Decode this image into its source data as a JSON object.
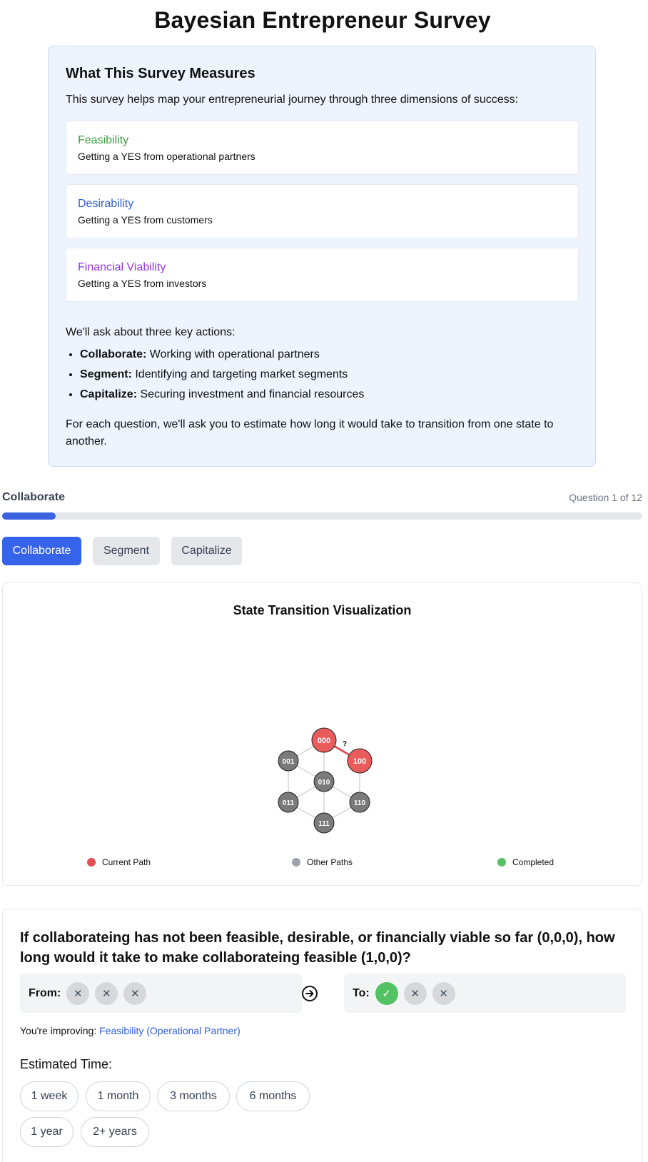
{
  "page_title": "Bayesian Entrepreneur Survey",
  "intro": {
    "heading": "What This Survey Measures",
    "lead": "This survey helps map your entrepreneurial journey through three dimensions of success:",
    "dimensions": [
      {
        "name": "Feasibility",
        "desc": "Getting a YES from operational partners",
        "color": "#3f9c46"
      },
      {
        "name": "Desirability",
        "desc": "Getting a YES from customers",
        "color": "#2f5fdc"
      },
      {
        "name": "Financial Viability",
        "desc": "Getting a YES from investors",
        "color": "#9333ea"
      }
    ],
    "actions_title": "We'll ask about three key actions:",
    "actions": [
      {
        "term": "Collaborate:",
        "desc": " Working with operational partners"
      },
      {
        "term": "Segment:",
        "desc": " Identifying and targeting market segments"
      },
      {
        "term": "Capitalize:",
        "desc": " Securing investment and financial resources"
      }
    ],
    "footnote": "For each question, we'll ask you to estimate how long it would take to transition from one state to another."
  },
  "progress": {
    "label": "Collaborate",
    "count": "Question 1 of 12",
    "fraction": 0.0833
  },
  "tabs": [
    "Collaborate",
    "Segment",
    "Capitalize"
  ],
  "active_tab": "Collaborate",
  "visualization": {
    "title": "State Transition Visualization",
    "nodes": [
      {
        "label": "000",
        "status": "current"
      },
      {
        "label": "100",
        "status": "current"
      },
      {
        "label": "001",
        "status": "other"
      },
      {
        "label": "010",
        "status": "other"
      },
      {
        "label": "011",
        "status": "other"
      },
      {
        "label": "110",
        "status": "other"
      },
      {
        "label": "111",
        "status": "other"
      }
    ],
    "edge_question_mark": "?",
    "legend": [
      {
        "label": "Current Path",
        "color": "#e05252"
      },
      {
        "label": "Other Paths",
        "color": "#9ca3af"
      },
      {
        "label": "Completed",
        "color": "#54c163"
      }
    ],
    "colors": {
      "current": "#ea5b5b",
      "other": "#7a7a7a",
      "edge_active": "#e05252",
      "edge": "#cccccc"
    }
  },
  "question": {
    "text": "If collaborateing has not been feasible, desirable, or financially viable so far (0,0,0), how long would it take to make collaborateing feasible (1,0,0)?",
    "from_label": "From:",
    "to_label": "To:",
    "from_states": [
      "no",
      "no",
      "no"
    ],
    "to_states": [
      "yes",
      "no",
      "no"
    ],
    "improving_prefix": "You're improving: ",
    "improving_dimension": "Feasibility (Operational Partner)",
    "estimate_title": "Estimated Time:",
    "options": [
      "1 week",
      "1 month",
      "3 months",
      "6 months",
      "1 year",
      "2+ years"
    ]
  }
}
